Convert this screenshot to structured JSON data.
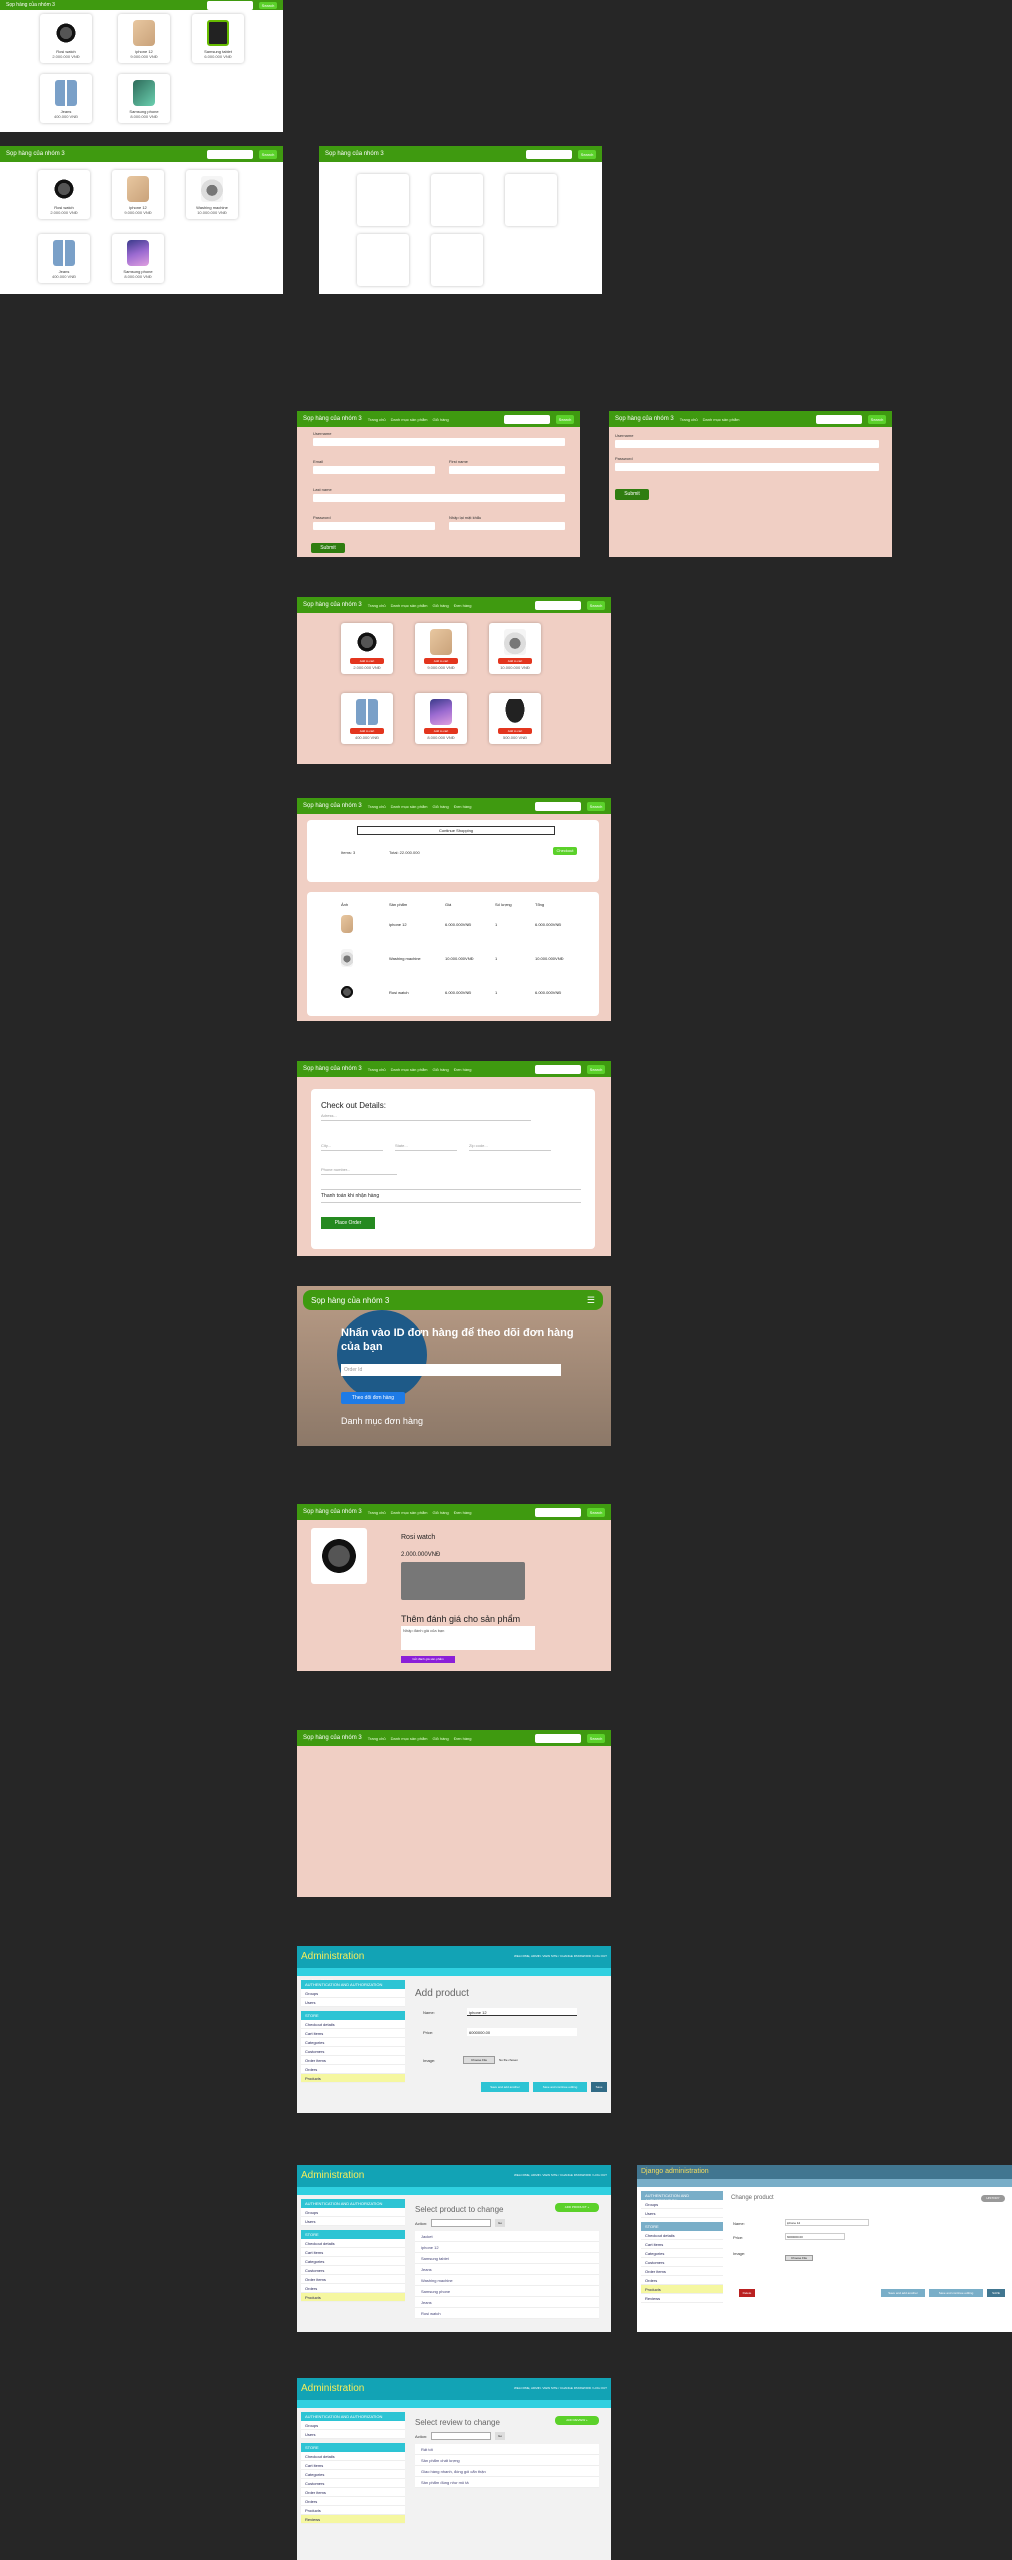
{
  "store": {
    "brand": "Sọp hàng của nhóm 3",
    "nav_links": [
      "Trang chủ",
      "Danh mục sản phẩm",
      "Giỏ hàng",
      "Đơn hàng",
      "Đăng nhập"
    ],
    "search_placeholder": "Search",
    "search_button": "Search"
  },
  "products": [
    {
      "name": "Rosi watch",
      "price": "2.000.000 VNĐ",
      "icon": "watch-image"
    },
    {
      "name": "iphone 12",
      "price": "9.000.000 VNĐ",
      "icon": "iphone-image"
    },
    {
      "name": "Samsung tablet",
      "price": "6.000.000 VNĐ",
      "icon": "tablet-image"
    },
    {
      "name": "Jeans",
      "price": "400.000 VNĐ",
      "icon": "jeans-image"
    },
    {
      "name": "Samsung phone",
      "price": "8.000.000 VNĐ",
      "icon": "phone-image"
    },
    {
      "name": "Washing machine",
      "price": "10.000.000 VNĐ",
      "icon": "washer-image"
    },
    {
      "name": "Jacket",
      "price": "500.000 VNĐ",
      "icon": "jacket-image"
    }
  ],
  "register_form": {
    "labels": [
      "Username",
      "Email",
      "First name",
      "Last name",
      "Password",
      "Nhập lại mật khẩu"
    ],
    "submit": "Submit"
  },
  "login_form": {
    "labels": [
      "Username",
      "Password"
    ],
    "submit": "Submit"
  },
  "shop_buttons": {
    "add_cart": "Add to cart",
    "view": "View"
  },
  "cart": {
    "continue": "Continue Shopping",
    "items_label": "Items: 3",
    "total_label": "Total: 22.000.000",
    "checkout": "Checkout",
    "headers": [
      "Ảnh",
      "Sản phẩm",
      "Giá",
      "Số lượng",
      "Tổng"
    ],
    "rows": [
      {
        "name": "iphone 12",
        "price": "6.000.000VNĐ",
        "qty": "1",
        "total": "6.000.000VNĐ"
      },
      {
        "name": "Washing machine",
        "price": "10.000.000VNĐ",
        "qty": "1",
        "total": "10.000.000VNĐ"
      },
      {
        "name": "Rosi watch",
        "price": "6.000.000VNĐ",
        "qty": "1",
        "total": "6.000.000VNĐ"
      }
    ]
  },
  "checkout": {
    "title": "Check out Details:",
    "address_placeholder": "Adress...",
    "city_placeholder": "City...",
    "state_placeholder": "State...",
    "zip_placeholder": "Zip code...",
    "phone_placeholder": "Phone number...",
    "payment": "Thanh toán khi nhận hàng",
    "place_order": "Place Order"
  },
  "track": {
    "brand": "Sọp hàng của nhóm 3",
    "heading": "Nhấn vào ID đơn hàng để theo dõi đơn hàng của bạn",
    "input_placeholder": "Order Id",
    "button": "Theo dõi đơn hàng",
    "category": "Danh mục đơn hàng"
  },
  "detail": {
    "name": "Rosi watch",
    "price": "2.000.000VNĐ",
    "review_title": "Thêm đánh giá cho sản phẩm",
    "review_placeholder": "Nhập đánh giá của bạn",
    "review_button": "Gửi đánh giá sản phẩm"
  },
  "admin": {
    "title": "Administration",
    "top_links": "WELCOME, ADMIN. VIEW SITE / CHANGE PASSWORD / LOG OUT",
    "breadcrumb": "Home › Store › Products",
    "add_title": "Add product",
    "name_label": "Name:",
    "name_value": "iphone 12",
    "price_label": "Price:",
    "price_value": "6000000.00",
    "image_label": "Image:",
    "image_button": "Choose File",
    "image_file": "No file chosen",
    "save_add": "Save and add another",
    "save_continue": "Save and continue editing",
    "save": "Save",
    "sidebar_sections": [
      {
        "header": "AUTHENTICATION AND AUTHORIZATION",
        "items": [
          "Groups",
          "Users"
        ]
      },
      {
        "header": "STORE",
        "items": [
          "Checkout details",
          "Cart items",
          "Categories",
          "Customers",
          "Order items",
          "Orders",
          "Products",
          "Reviews"
        ]
      }
    ],
    "select_change": "Select product to change",
    "add_button": "ADD PRODUCT +",
    "action_label": "Action:",
    "go": "Go",
    "product_list": [
      "Jacket",
      "iphone 12",
      "Samsung tablet",
      "Jeans",
      "Washing machine",
      "Samsung phone",
      "Jeans",
      "Rosi watch"
    ],
    "select_review": "Select review to change",
    "add_review": "ADD REVIEW +",
    "review_list": [
      "Rất tốt",
      "Sản phẩm chất lượng",
      "Giao hàng nhanh, đóng gói cẩn thận",
      "Sản phẩm đúng như mô tả"
    ]
  },
  "django_admin": {
    "title": "Django administration",
    "change_title": "Change product",
    "history": "HISTORY",
    "delete": "Delete",
    "save_add": "Save and add another",
    "save_continue": "Save and continue editing",
    "save": "SAVE"
  }
}
